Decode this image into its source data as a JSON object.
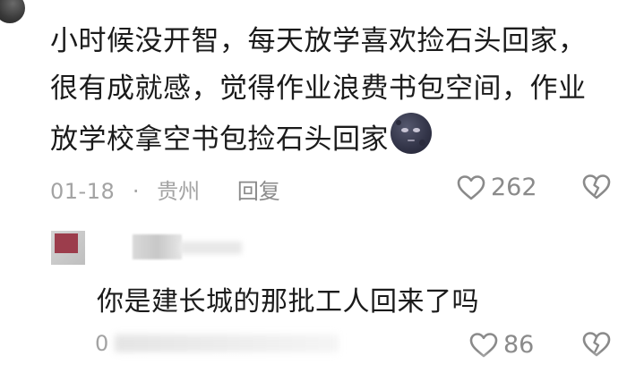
{
  "comment": {
    "lines": [
      "小时候没开智，每天放学喜欢捡石头回家，",
      "很有成就感，觉得作业浪费书包空间，作业",
      "放学校拿空书包捡石头回家"
    ],
    "emoji": "new-moon-face-emoji",
    "date": "01-18",
    "separator": "·",
    "location": "贵州",
    "reply_label": "回复",
    "like_count": "262"
  },
  "reply": {
    "text": "你是建长城的那批工人回来了吗",
    "meta_visible": "0",
    "like_count_visible": "86"
  },
  "colors": {
    "text": "#1b1b1b",
    "meta": "#a3a3a3",
    "avatar_accent": "#9c3d4c"
  }
}
